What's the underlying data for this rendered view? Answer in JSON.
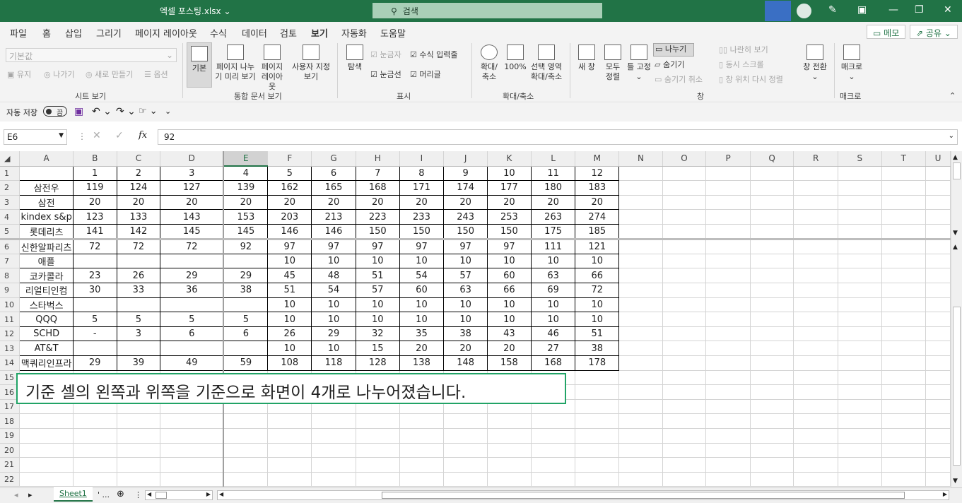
{
  "title": {
    "filename": "엑셀 포스팅.xlsx",
    "search": "검색"
  },
  "menu": {
    "tabs": [
      "파일",
      "홈",
      "삽입",
      "그리기",
      "페이지 레이아웃",
      "수식",
      "데이터",
      "검토",
      "보기",
      "자동화",
      "도움말"
    ],
    "active": "보기",
    "memo": "메모",
    "share": "공유"
  },
  "ribbon": {
    "sheet_view": {
      "dropdown": "기본값",
      "keep": "유지",
      "exit": "나가기",
      "new": "새로 만들기",
      "options": "옵션",
      "label": "시트 보기"
    },
    "workbook_views": {
      "normal": "기본",
      "page_break": "페이지 나누기 미리 보기",
      "page_layout": "페이지 레이아웃",
      "custom": "사용자 지정 보기",
      "label": "통합 문서 보기"
    },
    "show": {
      "navigate": "탐색",
      "ruler": "눈금자",
      "formula_bar": "수식 입력줄",
      "gridlines": "눈금선",
      "headings": "머리글",
      "label": "표시"
    },
    "zoom": {
      "zoom": "확대/축소",
      "hundred": "100%",
      "to_selection": "선택 영역 확대/축소",
      "label": "확대/축소"
    },
    "window": {
      "new_window": "새 창",
      "arrange_all": "모두 정렬",
      "freeze": "틀 고정",
      "split": "나누기",
      "hide": "숨기기",
      "unhide": "숨기기 취소",
      "side_by_side": "나란히 보기",
      "sync_scroll": "동시 스크롤",
      "reset_position": "창 위치 다시 정렬",
      "switch": "창 전환",
      "label": "창"
    },
    "macros": {
      "macros": "매크로",
      "label": "매크로"
    }
  },
  "qat": {
    "autosave": "자동 저장",
    "toggle": "끔"
  },
  "formula_bar": {
    "name_box": "E6",
    "fx": "fx",
    "value": "92"
  },
  "columns": [
    "A",
    "B",
    "C",
    "D",
    "E",
    "F",
    "G",
    "H",
    "I",
    "J",
    "K",
    "L",
    "M",
    "N",
    "O",
    "P",
    "Q",
    "R",
    "S",
    "T",
    "U"
  ],
  "rows": [
    {
      "n": "1",
      "a": "",
      "v": [
        "1",
        "2",
        "3",
        "4",
        "5",
        "6",
        "7",
        "8",
        "9",
        "10",
        "11",
        "12"
      ]
    },
    {
      "n": "2",
      "a": "삼전우",
      "v": [
        "119",
        "124",
        "127",
        "139",
        "162",
        "165",
        "168",
        "171",
        "174",
        "177",
        "180",
        "183"
      ]
    },
    {
      "n": "3",
      "a": "삼전",
      "v": [
        "20",
        "20",
        "20",
        "20",
        "20",
        "20",
        "20",
        "20",
        "20",
        "20",
        "20",
        "20"
      ]
    },
    {
      "n": "4",
      "a": "kindex s&p",
      "v": [
        "123",
        "133",
        "143",
        "153",
        "203",
        "213",
        "223",
        "233",
        "243",
        "253",
        "263",
        "274"
      ]
    },
    {
      "n": "5",
      "a": "롯데리츠",
      "v": [
        "141",
        "142",
        "145",
        "145",
        "146",
        "146",
        "150",
        "150",
        "150",
        "150",
        "175",
        "185"
      ]
    },
    {
      "n": "6",
      "a": "신한알파리츠",
      "v": [
        "72",
        "72",
        "72",
        "92",
        "97",
        "97",
        "97",
        "97",
        "97",
        "97",
        "111",
        "121"
      ]
    },
    {
      "n": "7",
      "a": "애플",
      "v": [
        "",
        "",
        "",
        "",
        "10",
        "10",
        "10",
        "10",
        "10",
        "10",
        "10",
        "10"
      ]
    },
    {
      "n": "8",
      "a": "코카콜라",
      "v": [
        "23",
        "26",
        "29",
        "29",
        "45",
        "48",
        "51",
        "54",
        "57",
        "60",
        "63",
        "66"
      ]
    },
    {
      "n": "9",
      "a": "리얼티인컴",
      "v": [
        "30",
        "33",
        "36",
        "38",
        "51",
        "54",
        "57",
        "60",
        "63",
        "66",
        "69",
        "72"
      ]
    },
    {
      "n": "10",
      "a": "스타벅스",
      "v": [
        "",
        "",
        "",
        "",
        "10",
        "10",
        "10",
        "10",
        "10",
        "10",
        "10",
        "10"
      ]
    },
    {
      "n": "11",
      "a": "QQQ",
      "v": [
        "5",
        "5",
        "5",
        "5",
        "10",
        "10",
        "10",
        "10",
        "10",
        "10",
        "10",
        "10"
      ]
    },
    {
      "n": "12",
      "a": "SCHD",
      "v": [
        "-",
        "3",
        "6",
        "6",
        "26",
        "29",
        "32",
        "35",
        "38",
        "43",
        "46",
        "51"
      ]
    },
    {
      "n": "13",
      "a": "AT&T",
      "v": [
        "",
        "",
        "",
        "",
        "10",
        "10",
        "15",
        "20",
        "20",
        "20",
        "27",
        "38"
      ]
    },
    {
      "n": "14",
      "a": "맥쿼리인프라",
      "v": [
        "29",
        "39",
        "49",
        "59",
        "108",
        "118",
        "128",
        "138",
        "148",
        "158",
        "168",
        "178"
      ]
    },
    {
      "n": "15",
      "a": "",
      "v": []
    },
    {
      "n": "16",
      "a": "",
      "v": []
    },
    {
      "n": "17",
      "a": "",
      "v": []
    },
    {
      "n": "18",
      "a": "",
      "v": []
    },
    {
      "n": "19",
      "a": "",
      "v": []
    },
    {
      "n": "20",
      "a": "",
      "v": []
    },
    {
      "n": "21",
      "a": "",
      "v": []
    },
    {
      "n": "22",
      "a": "",
      "v": []
    }
  ],
  "callout": "기준 셀의 왼쪽과 위쪽을 기준으로 화면이 4개로 나누어졌습니다.",
  "sheets": {
    "active": "Sheet1",
    "more": "' ..."
  },
  "colors": {
    "accent": "#217346",
    "callout_border": "#21a366"
  }
}
